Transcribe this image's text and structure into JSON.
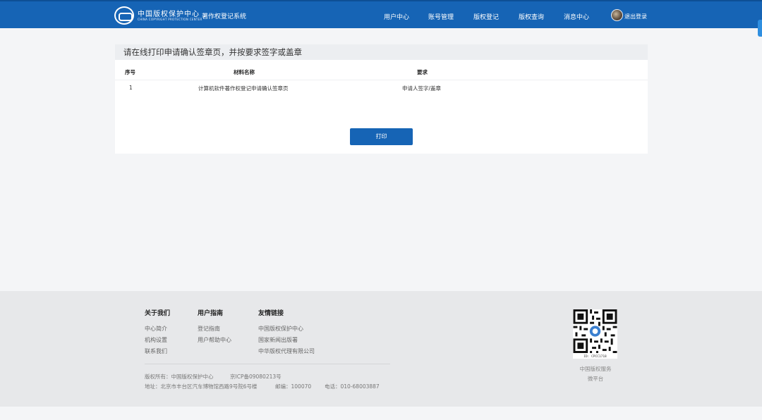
{
  "header": {
    "logo_cn": "中国版权保护中心",
    "logo_en": "CHINA COPYRIGHT PROTECTION CENTER",
    "system_name": "著作权登记系统",
    "nav": [
      "用户中心",
      "账号管理",
      "版权登记",
      "版权查询",
      "消息中心"
    ],
    "logout": "退出登录"
  },
  "card": {
    "title": "请在线打印申请确认签章页，并按要求签字或盖章",
    "columns": [
      "序号",
      "材料名称",
      "要求"
    ],
    "rows": [
      {
        "index": "1",
        "name": "计算机软件著作权登记申请确认签章页",
        "requirement": "申请人签字/盖章"
      }
    ],
    "print_button": "打印"
  },
  "footer": {
    "sections": [
      {
        "heading": "关于我们",
        "links": [
          "中心简介",
          "机构设置",
          "联系我们"
        ]
      },
      {
        "heading": "用户指南",
        "links": [
          "登记指南",
          "用户帮助中心"
        ]
      },
      {
        "heading": "友情链接",
        "links": [
          "中国版权保护中心",
          "国家新闻出版署",
          "中华版权代理有限公司"
        ]
      }
    ],
    "copyright": "版权所有：中国版权保护中心",
    "icp": "京ICP备09080213号",
    "address": "地址：北京市丰台区汽车博物馆西路9号院6号楼",
    "postcode": "邮编：100070",
    "phone": "电话：010-68003887",
    "qr_id": "ID: CPCC1718",
    "qr_caption_1": "中国版权服务",
    "qr_caption_2": "微平台"
  },
  "colors": {
    "brand_blue": "#1664b5",
    "footer_bg": "#e7e8ea",
    "page_bg": "#f4f5f7"
  }
}
